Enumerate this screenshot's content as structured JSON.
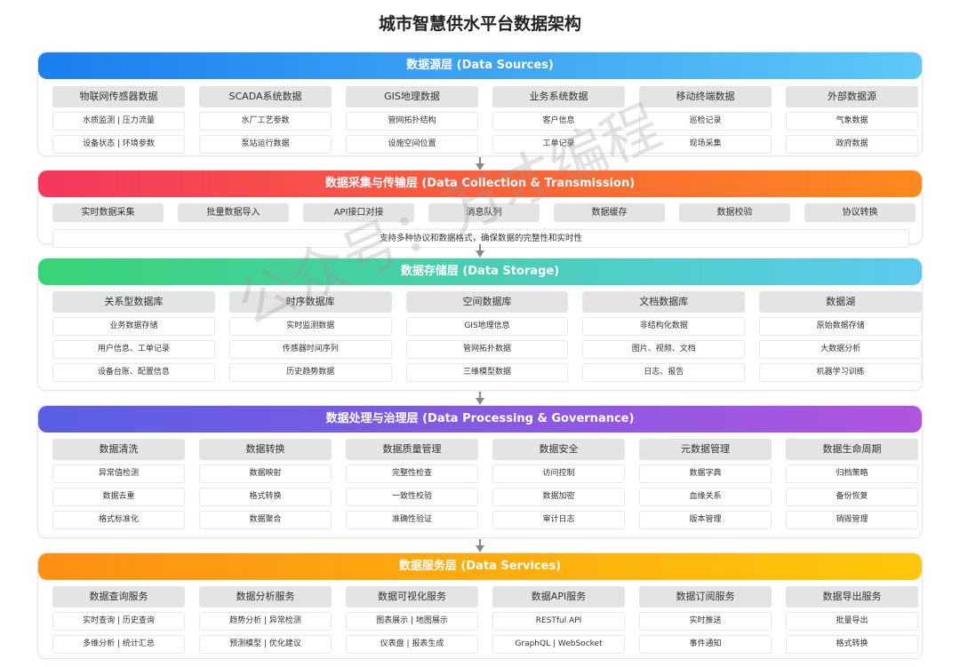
{
  "title": "城市智慧供水平台数据架构",
  "watermark": "公众号：万才编程",
  "layers": {
    "sources": {
      "header": "数据源层 (Data Sources)",
      "columns": [
        {
          "name": "物联网传感器数据",
          "items": [
            "水质监测 | 压力流量",
            "设备状态 | 环境参数"
          ]
        },
        {
          "name": "SCADA系统数据",
          "items": [
            "水厂工艺参数",
            "泵站运行数据"
          ]
        },
        {
          "name": "GIS地理数据",
          "items": [
            "管网拓扑结构",
            "设施空间位置"
          ]
        },
        {
          "name": "业务系统数据",
          "items": [
            "客户信息",
            "工单记录"
          ]
        },
        {
          "name": "移动终端数据",
          "items": [
            "巡检记录",
            "现场采集"
          ]
        },
        {
          "name": "外部数据源",
          "items": [
            "气象数据",
            "政府数据"
          ]
        }
      ]
    },
    "collection": {
      "header": "数据采集与传输层 (Data Collection & Transmission)",
      "chips": [
        "实时数据采集",
        "批量数据导入",
        "API接口对接",
        "消息队列",
        "数据缓存",
        "数据校验",
        "协议转换"
      ],
      "note": "支持多种协议和数据格式，确保数据的完整性和实时性"
    },
    "storage": {
      "header": "数据存储层 (Data Storage)",
      "columns": [
        {
          "name": "关系型数据库",
          "items": [
            "业务数据存储",
            "用户信息、工单记录",
            "设备台账、配置信息"
          ]
        },
        {
          "name": "时序数据库",
          "items": [
            "实时监测数据",
            "传感器时间序列",
            "历史趋势数据"
          ]
        },
        {
          "name": "空间数据库",
          "items": [
            "GIS地理信息",
            "管网拓扑数据",
            "三维模型数据"
          ]
        },
        {
          "name": "文档数据库",
          "items": [
            "非结构化数据",
            "图片、视频、文档",
            "日志、报告"
          ]
        },
        {
          "name": "数据湖",
          "items": [
            "原始数据存储",
            "大数据分析",
            "机器学习训练"
          ]
        }
      ]
    },
    "processing": {
      "header": "数据处理与治理层 (Data Processing & Governance)",
      "columns": [
        {
          "name": "数据清洗",
          "items": [
            "异常值检测",
            "数据去重",
            "格式标准化"
          ]
        },
        {
          "name": "数据转换",
          "items": [
            "数据映射",
            "格式转换",
            "数据聚合"
          ]
        },
        {
          "name": "数据质量管理",
          "items": [
            "完整性检查",
            "一致性校验",
            "准确性验证"
          ]
        },
        {
          "name": "数据安全",
          "items": [
            "访问控制",
            "数据加密",
            "审计日志"
          ]
        },
        {
          "name": "元数据管理",
          "items": [
            "数据字典",
            "血缘关系",
            "版本管理"
          ]
        },
        {
          "name": "数据生命周期",
          "items": [
            "归档策略",
            "备份恢复",
            "销毁管理"
          ]
        }
      ]
    },
    "services": {
      "header": "数据服务层 (Data Services)",
      "columns": [
        {
          "name": "数据查询服务",
          "items": [
            "实时查询 | 历史查询",
            "多维分析 | 统计汇总"
          ]
        },
        {
          "name": "数据分析服务",
          "items": [
            "趋势分析 | 异常检测",
            "预测模型 | 优化建议"
          ]
        },
        {
          "name": "数据可视化服务",
          "items": [
            "图表展示 | 地图展示",
            "仪表盘 | 报表生成"
          ]
        },
        {
          "name": "数据API服务",
          "items": [
            "RESTful API",
            "GraphQL | WebSocket"
          ]
        },
        {
          "name": "数据订阅服务",
          "items": [
            "实时推送",
            "事件通知"
          ]
        },
        {
          "name": "数据导出服务",
          "items": [
            "批量导出",
            "格式转换"
          ]
        }
      ]
    }
  }
}
